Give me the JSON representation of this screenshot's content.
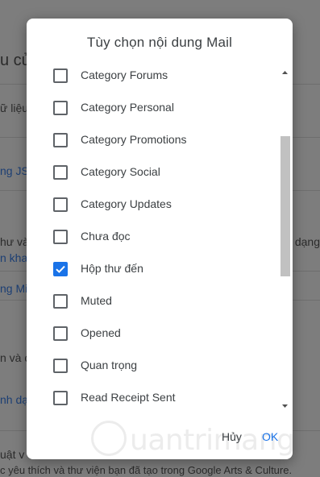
{
  "background": {
    "heading_fragment": "u củ",
    "row1": "ữ liệu",
    "link1": "ng JS",
    "row2_left": "hư và",
    "row2_right": "dạng",
    "link2": "n kha",
    "link3": "ng Mi",
    "row3": "n và c",
    "link4": "nh dạ",
    "row4": "uật v",
    "footer_line": "c yêu thích và thư viện bạn đã tạo trong Google Arts & Culture."
  },
  "dialog": {
    "title": "Tùy chọn nội dung Mail",
    "items": [
      {
        "label": "Category Forums",
        "checked": false
      },
      {
        "label": "Category Personal",
        "checked": false
      },
      {
        "label": "Category Promotions",
        "checked": false
      },
      {
        "label": "Category Social",
        "checked": false
      },
      {
        "label": "Category Updates",
        "checked": false
      },
      {
        "label": "Chưa đọc",
        "checked": false
      },
      {
        "label": "Hộp thư đến",
        "checked": true
      },
      {
        "label": "Muted",
        "checked": false
      },
      {
        "label": "Opened",
        "checked": false
      },
      {
        "label": "Quan trọng",
        "checked": false
      },
      {
        "label": "Read Receipt Sent",
        "checked": false
      }
    ],
    "cancel_label": "Hủy",
    "ok_label": "OK"
  },
  "watermark": {
    "text": "uantrimang"
  },
  "colors": {
    "accent": "#1a73e8",
    "checkbox_border": "#5f6368",
    "text": "#3c4043"
  },
  "icons": {
    "checkmark": "check-icon",
    "scroll_up": "arrow-up-icon",
    "scroll_down": "arrow-down-icon",
    "watermark_logo": "lightbulb-logo"
  }
}
